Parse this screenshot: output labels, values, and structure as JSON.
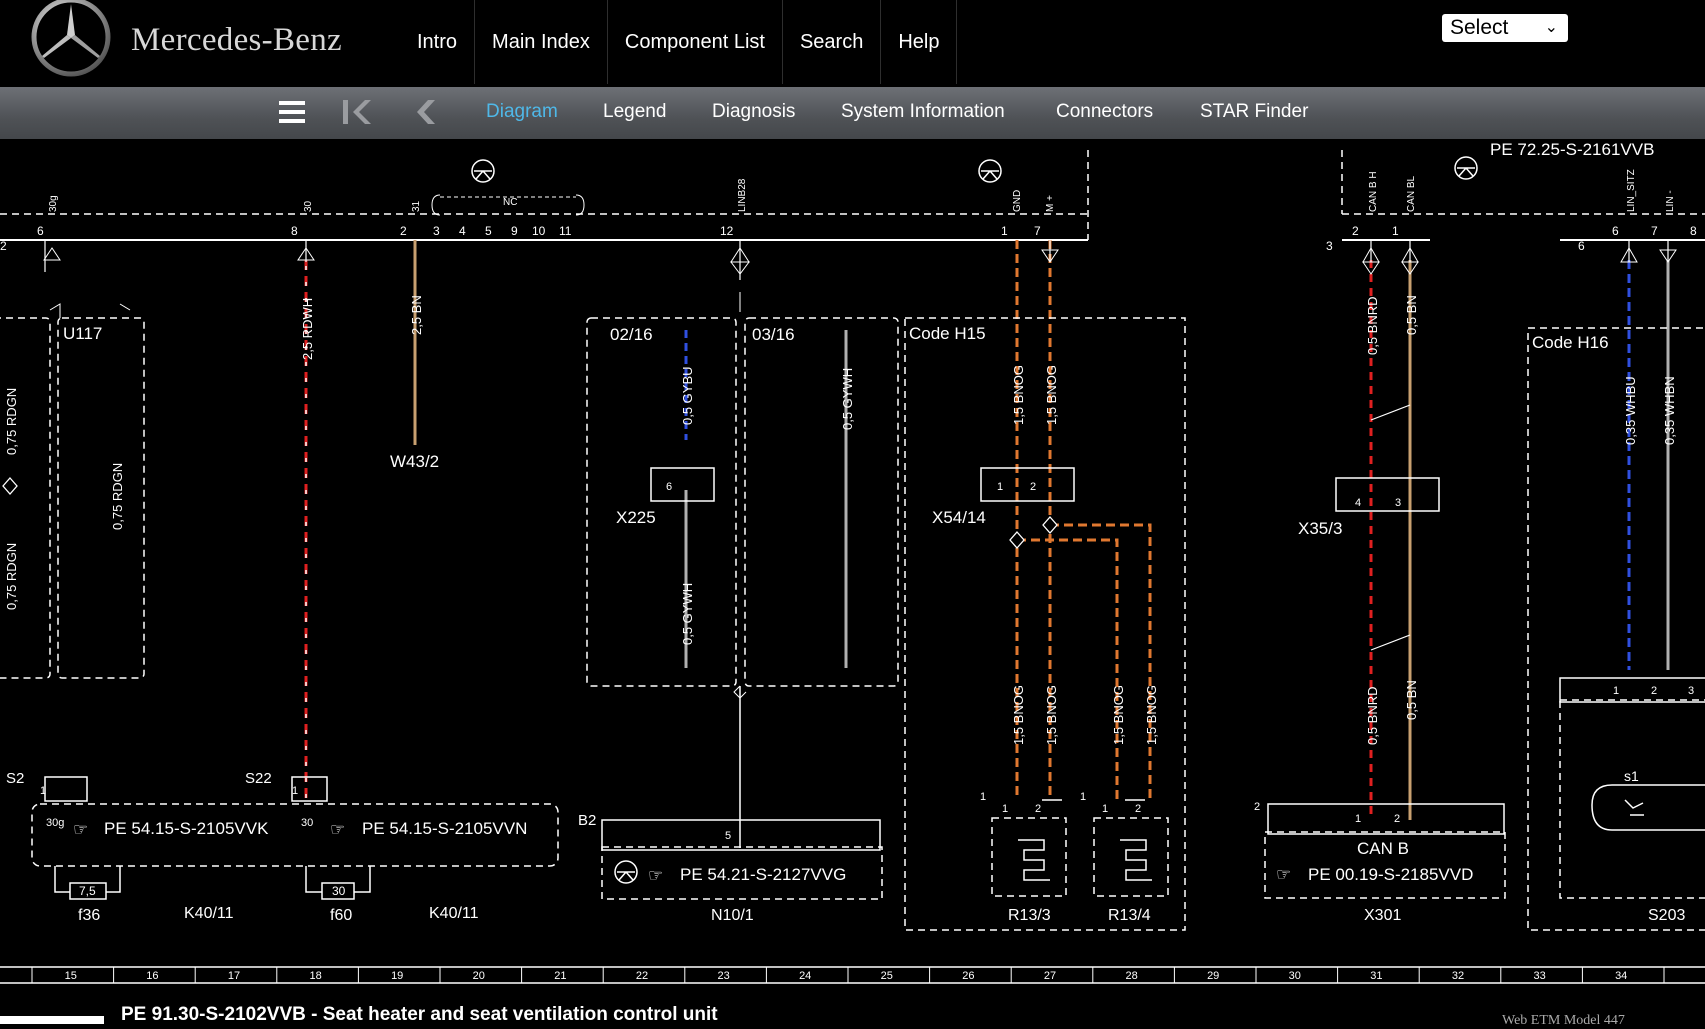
{
  "header": {
    "brand": "Mercedes-Benz",
    "nav": [
      "Intro",
      "Main Index",
      "Component List",
      "Search",
      "Help"
    ],
    "select_value": "Select"
  },
  "toolbar": {
    "icons": [
      "menu-icon",
      "first-page-icon",
      "previous-page-icon"
    ],
    "tabs": [
      "Diagram",
      "Legend",
      "Diagnosis",
      "System Information",
      "Connectors",
      "STAR Finder"
    ],
    "active_tab": "Diagram",
    "active_color": "#4fb8e8"
  },
  "diagram": {
    "pin_labels": [
      "30g",
      "30",
      "31",
      "NC",
      "LINB28",
      "GND",
      "M +",
      "CAN B H",
      "CAN BL",
      "LIN_SITZ",
      "LIN -"
    ],
    "pin_numbers": [
      "2",
      "6",
      "8",
      "2",
      "3",
      "4",
      "5",
      "9",
      "10",
      "11",
      "12",
      "1",
      "7",
      "3",
      "2",
      "1",
      "6",
      "6",
      "7",
      "8"
    ],
    "wires": [
      "0,75 RDGN",
      "0,75 RDGN",
      "0,75 RDGN",
      "2,5 RDWH",
      "2,5 BN",
      "0,5 GYBU",
      "0,5 GYWH",
      "0,5 GYWH",
      "1,5 BNOG",
      "1,5 BNOG",
      "1,5 BNOG",
      "1,5 BNOG",
      "1,5 BNOG",
      "1,5 BNOG",
      "0,5 BNRD",
      "0,5 BN",
      "0,5 BNRD",
      "0,5 BN",
      "0,35 WHBU",
      "0,35 WHBN"
    ],
    "blocks": [
      "U117",
      "02/16",
      "03/16",
      "Code H15",
      "Code H16"
    ],
    "components": [
      "W43/2",
      "X225",
      "X54/14",
      "X35/3",
      "S2",
      "S22",
      "B2",
      "f36",
      "K40/11",
      "f60",
      "K40/11",
      "N10/1",
      "R13/3",
      "R13/4",
      "X301",
      "S203",
      "s1",
      "CAN B"
    ],
    "references": [
      "PE 54.15-S-2105VVK",
      "PE 54.15-S-2105VVN",
      "PE 54.21-S-2127VVG",
      "PE 00.19-S-2185VVD"
    ],
    "fuse_values": [
      "7,5",
      "30"
    ],
    "small_pins": [
      "30g",
      "30",
      "1",
      "1",
      "5",
      "6",
      "1",
      "2",
      "4",
      "3",
      "1",
      "2",
      "1",
      "2",
      "1",
      "2",
      "1",
      "2",
      "3",
      "1",
      "1",
      "2"
    ],
    "top_ref": "PE 72.25-S-2161VVB",
    "wire_colors": {
      "red": "#e02020",
      "brown": "#c8a070",
      "orange": "#e07830",
      "blue": "#3050e0",
      "green": "#20c040",
      "grey": "#b0b0b0"
    }
  },
  "ruler": {
    "numbers": [
      "15",
      "16",
      "17",
      "18",
      "19",
      "20",
      "21",
      "22",
      "23",
      "24",
      "25",
      "26",
      "27",
      "28",
      "29",
      "30",
      "31",
      "32",
      "33",
      "34"
    ]
  },
  "footer": {
    "title": "PE 91.30-S-2102VVB - Seat heater and seat ventilation control unit",
    "model": "Web ETM Model 447"
  }
}
